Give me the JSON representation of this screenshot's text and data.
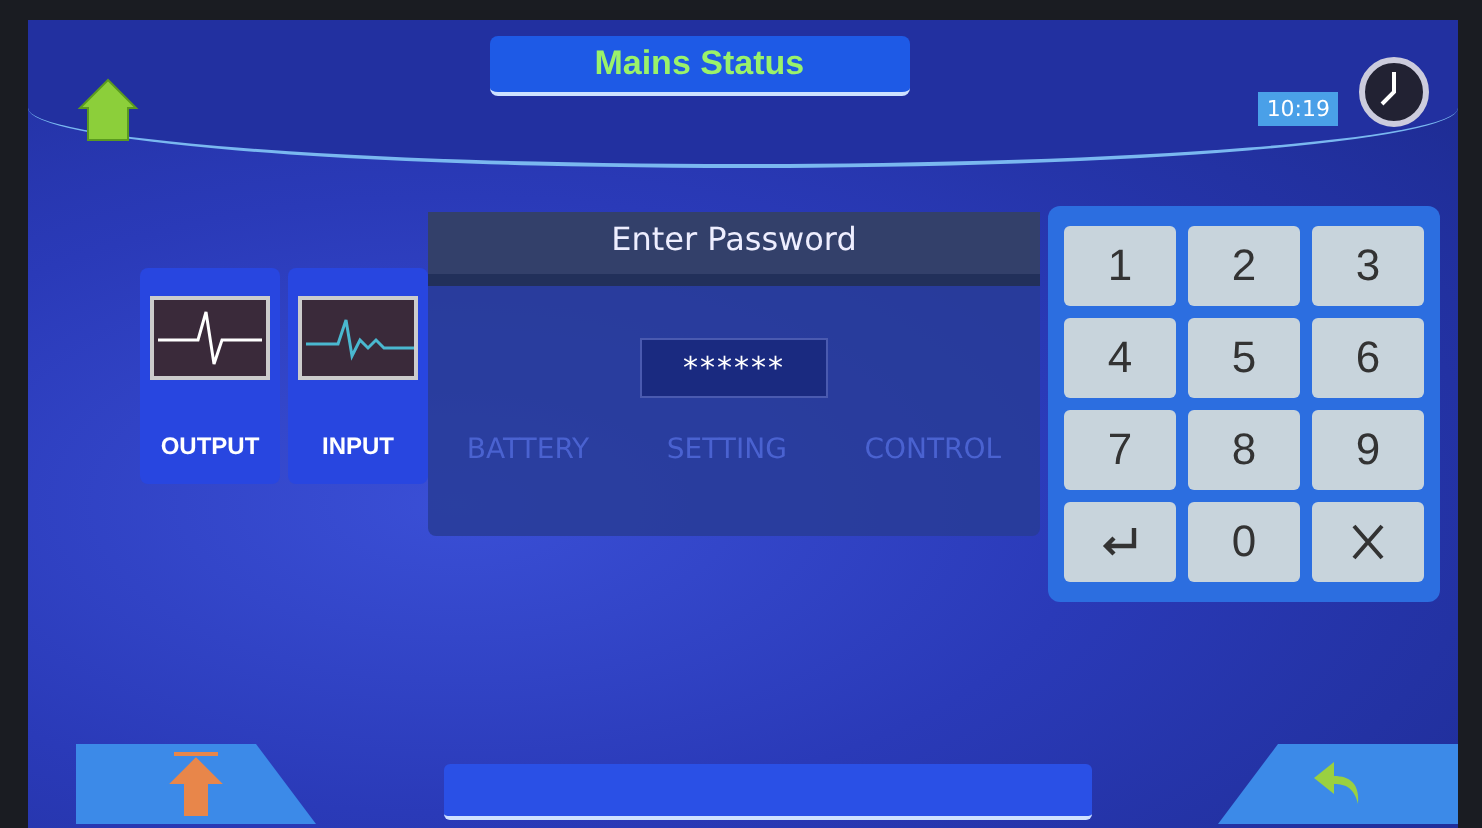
{
  "header": {
    "title": "Mains Status",
    "time": "10:19"
  },
  "tiles": [
    {
      "label": "OUTPUT"
    },
    {
      "label": "INPUT"
    }
  ],
  "background_menu": [
    "BATTERY",
    "SETTING",
    "CONTROL"
  ],
  "dialog": {
    "title": "Enter Password",
    "value": "******"
  },
  "keypad": [
    {
      "kind": "digit",
      "label": "1"
    },
    {
      "kind": "digit",
      "label": "2"
    },
    {
      "kind": "digit",
      "label": "3"
    },
    {
      "kind": "digit",
      "label": "4"
    },
    {
      "kind": "digit",
      "label": "5"
    },
    {
      "kind": "digit",
      "label": "6"
    },
    {
      "kind": "digit",
      "label": "7"
    },
    {
      "kind": "digit",
      "label": "8"
    },
    {
      "kind": "digit",
      "label": "9"
    },
    {
      "kind": "enter"
    },
    {
      "kind": "digit",
      "label": "0"
    },
    {
      "kind": "clear"
    }
  ]
}
